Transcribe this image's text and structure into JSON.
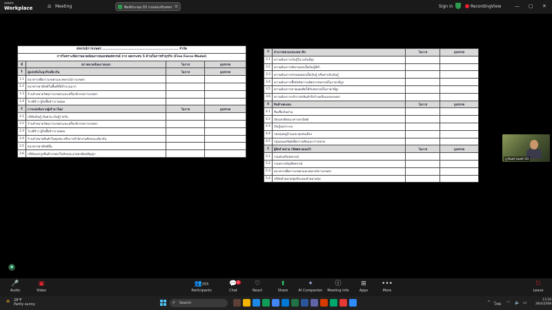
{
  "zoom": {
    "brand_line1": "zoom",
    "brand_line2": "Workplace",
    "meeting_label": "Meeting",
    "meeting_title": "พิมพ์ประชุม 03 กรมส่งเสริมสหกรณ์ร่วม",
    "signin": "Sign in",
    "recording": "Recording",
    "view": "View"
  },
  "slide": {
    "left": {
      "title1": "สหกรณ์การเกษตร ............................................................... จำกัด",
      "title2": "การวิเคราะห์สภาพแวดล้อมภายนอกต่อสหกรณ์ จาก ผลกระทบ 5 ด้านในการทำธุรกิจ (Five Force Model)",
      "col_no": "ที่",
      "col_env": "สภาพแวดล้อมภายนอก",
      "col_opp": "โอกาส",
      "col_thr": "อุปสรรค",
      "sections": [
        {
          "num": "1",
          "title": "คู่แข่งขันในธุรกิจเดียวกัน",
          "opp": "โอกาส",
          "thr": "อุปสรรค",
          "rows": [
            {
              "num": "1.1",
              "text": "ธนาคารเพื่อการเกษตรและสหกรณ์การเกษตร"
            },
            {
              "num": "1.2",
              "text": "ธนาคารพาณิชย์ในพื้นที่ที่มีจำนวนมาก"
            },
            {
              "num": "1.3",
              "text": "ร้านจำหน่ายวัสดุการเกษตรและเครื่องจักรกลการเกษตร"
            },
            {
              "num": "1.4",
              "text": "โรงสีข้าว ผู้รับซื้อข้าวรายย่อย"
            }
          ]
        },
        {
          "num": "2",
          "title": "การแข่งขันจากผู้เข้ามาใหม่",
          "opp": "โอกาส",
          "thr": "อุปสรรค",
          "rows": [
            {
              "num": "2.1",
              "text": "บริษัทเงินกู้ เงินด่วน เงินกู้รายวัน"
            },
            {
              "num": "2.2",
              "text": "ร้านจำหน่ายวัสดุการเกษตรและเครื่องจักรกลการเกษตร"
            },
            {
              "num": "2.3",
              "text": "โรงสีข้าว ผู้รับซื้อข้าวรายย่อย"
            },
            {
              "num": "2.4",
              "text": "ร้านจำหน่ายสินค้าในชุมชน หรือการสำนักงานสักษณะเดียวกัน"
            },
            {
              "num": "2.5",
              "text": "ธนาคารพาณิชย์อื่น"
            },
            {
              "num": "2.6",
              "text": "บริษัทแปรรูปสินค้าเกษตรในลักษณะเกษตรพันธสัญญา"
            }
          ]
        }
      ]
    },
    "right": {
      "sections": [
        {
          "num": "3",
          "title": "อำนาจต่อรองของสมาชิก",
          "opp": "โอกาส",
          "thr": "อุปสรรค",
          "rows": [
            {
              "num": "3.1",
              "text": "ความต้องการเงินกู้ในวงเงินที่สูง"
            },
            {
              "num": "3.2",
              "text": "ความต้องการอัตราดอกเบี้ยเงินกู้ที่ต่ำ"
            },
            {
              "num": "3.3",
              "text": "ความต้องการส่วนลดดอกเบี้ยเงินกู้ หรือค่าปรับเงินกู้"
            },
            {
              "num": "3.4",
              "text": "ความต้องการซื้อปัจจัยการผลิตจากสหกรณ์ในราคาที่ถูก"
            },
            {
              "num": "3.5",
              "text": "ความต้องการขายผลผลิตให้กับสหกรณ์ในราคาที่สูง"
            },
            {
              "num": "3.6",
              "text": "ความต้องการบริการส่งสินค้าถึงบ้านหรือแปลงเกษตร"
            }
          ]
        },
        {
          "num": "4",
          "title": "สินค้าทดแทน",
          "opp": "โอกาส",
          "thr": "อุปสรรค",
          "rows": [
            {
              "num": "4.1",
              "text": "สินเชื่อเงินด่วน"
            },
            {
              "num": "4.2",
              "text": "บัตรเครดิตธนาคารพาณิชย์"
            },
            {
              "num": "4.3",
              "text": "เงินกู้นอกระบบ"
            },
            {
              "num": "4.4",
              "text": "กองทุนหมู่บ้านและชุมชนเมือง"
            },
            {
              "num": "4.5",
              "text": "กลุ่มออมทรัพย์เพื่อการผลิตและการตลาด"
            }
          ]
        },
        {
          "num": "5",
          "title": "ผู้จัดจำหน่าย (ซัพพลายเออร์)",
          "opp": "โอกาส",
          "thr": "อุปสรรค",
          "rows": [
            {
              "num": "5.1",
              "text": "กรมส่งเสริมสหกรณ์"
            },
            {
              "num": "5.2",
              "text": "กรมตรวจบัญชีสหกรณ์"
            },
            {
              "num": "5.3",
              "text": "ธนาคารเพื่อการเกษตรและสหกรณ์การเกษตร"
            },
            {
              "num": "5.4",
              "text": "บริษัทจำหน่ายปุ๋ย/ตัวแทนจำหน่ายปุ๋ย"
            }
          ]
        }
      ]
    }
  },
  "participant": {
    "name": "ภูวรินทร์ ทองคำ 03"
  },
  "controls": {
    "audio": "Audio",
    "video": "Video",
    "participants": "Participants",
    "participants_count": "255",
    "chat": "Chat",
    "chat_badge": "3",
    "react": "React",
    "share": "Share",
    "ai": "AI Companion",
    "info": "Meeting info",
    "apps": "Apps",
    "more": "More",
    "leave": "Leave"
  },
  "taskbar": {
    "temp": "28°F",
    "weather": "Partly sunny",
    "search": "Search",
    "lang": "ไทย",
    "time": "13:10",
    "date": "28/4/2568"
  }
}
